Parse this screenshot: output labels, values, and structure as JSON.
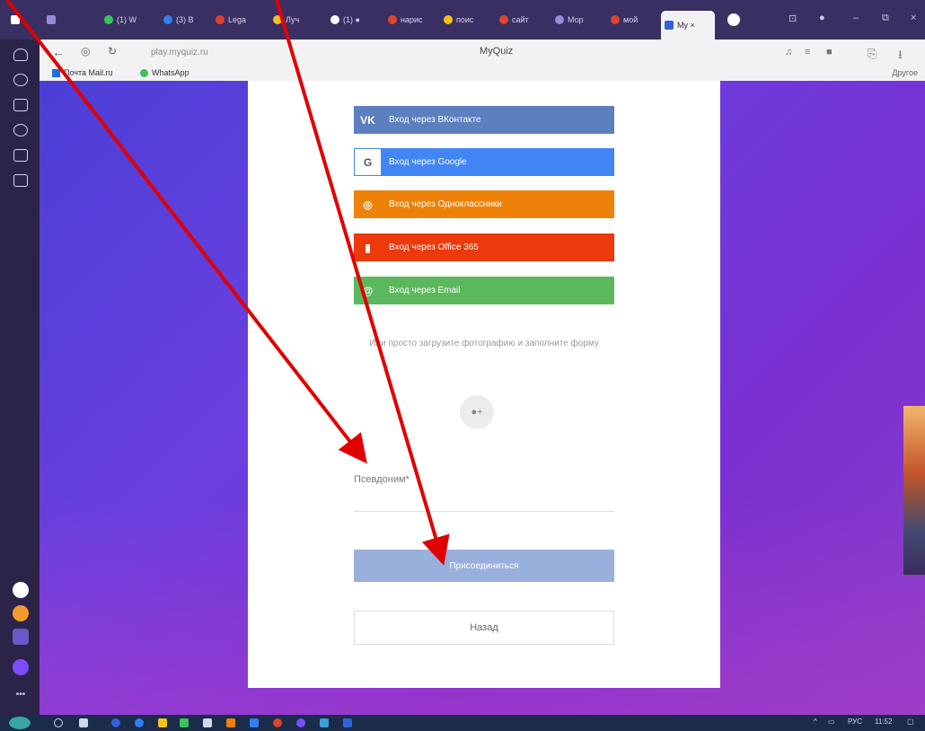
{
  "browser": {
    "tabs": [
      {
        "label": "(1) W",
        "color": "#3ac35a"
      },
      {
        "label": "(3) В",
        "color": "#2f7ff0"
      },
      {
        "label": "Lega",
        "color": "#e0442b"
      },
      {
        "label": "Луч",
        "color": "#f4c21b"
      },
      {
        "label": "(1) ●",
        "color": "#ffffff"
      },
      {
        "label": "нарис",
        "color": "#e0442b"
      },
      {
        "label": "поис",
        "color": "#f4c21b"
      },
      {
        "label": "сайт",
        "color": "#e0442b"
      },
      {
        "label": "Мор",
        "color": "#9a88d8"
      },
      {
        "label": "мой",
        "color": "#e0442b"
      }
    ],
    "active_tab": {
      "label": "My ×",
      "color": "#2f63d6"
    },
    "url": "play.myquiz.ru",
    "page_title": "MyQuiz",
    "bookmarks": [
      {
        "label": "Почта Mail.ru",
        "color": "#1e6fd9"
      },
      {
        "label": "WhatsApp",
        "color": "#3ac35a"
      }
    ],
    "bookmarks_other": "Другое"
  },
  "login": {
    "vk": {
      "icon": "vk-icon",
      "label": "Вход через ВКонтакте"
    },
    "google": {
      "icon": "google-icon",
      "label": "Вход через Google",
      "icon_text": "G"
    },
    "ok": {
      "icon": "odnoklassniki-icon",
      "label": "Вход через Одноклассники"
    },
    "office": {
      "icon": "office-icon",
      "label": "Вход через Office 365"
    },
    "email": {
      "icon": "email-icon",
      "label": "Вход через Email"
    }
  },
  "form": {
    "or_text": "Или просто загрузите фотографию и заполните форму",
    "nickname_label": "Псевдоним*",
    "nickname_value": "",
    "join_label": "Присоединиться",
    "back_label": "Назад"
  },
  "taskbar": {
    "lang": "РУС",
    "time": "11:52"
  },
  "colors": {
    "annotation_arrow": "#e00000",
    "page_gradient_start": "#4b3fd6",
    "page_gradient_end": "#8a3ec8"
  }
}
